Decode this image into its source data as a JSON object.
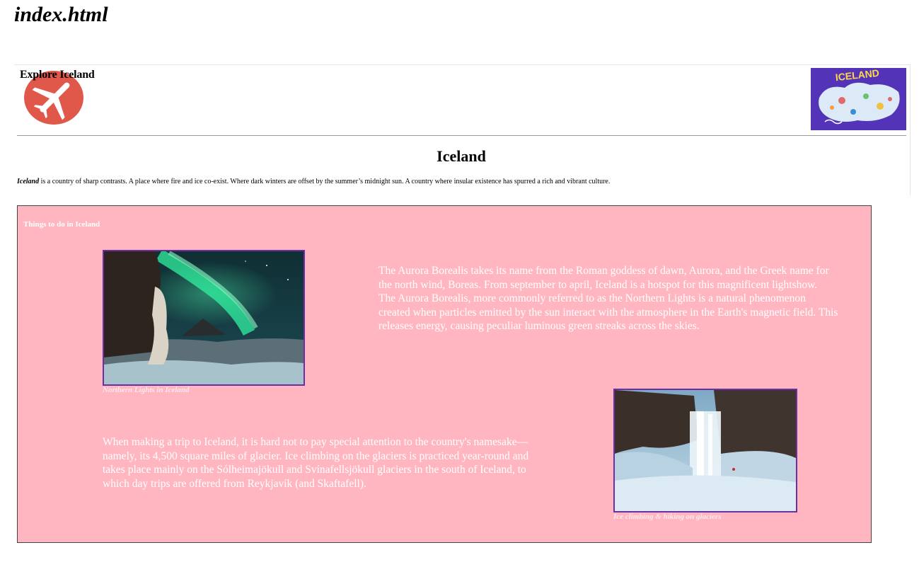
{
  "file_title": "index.html",
  "header": {
    "brand": "Explore Iceland",
    "logo_icon": "airplane-icon",
    "map_icon": "iceland-map-icon",
    "map_text": "ICELAND"
  },
  "main": {
    "heading": "Iceland",
    "intro_lead": "Iceland",
    "intro_rest": " is a country of sharp contrasts. A place where fire and ice co-exist. Where dark winters are offset by the summer’s midnight sun. A country where insular existence has spurred a rich and vibrant culture."
  },
  "things": {
    "heading": "Things to do in Iceland",
    "background": "#ffb6c1",
    "aurora": {
      "caption": "Northern Lights in Iceland",
      "para1": "The Aurora Borealis takes its name from the Roman goddess of dawn, Aurora, and the Greek name for the north wind, Boreas. From september to april, Iceland is a hotspot for this magnificent lightshow.",
      "para2": "The Aurora Borealis, more commonly referred to as the Northern Lights is a natural phenomenon created when particles emitted by the sun interact with the atmosphere in the Earth's magnetic field. This releases energy, causing peculiar luminous green streaks across the skies."
    },
    "ice": {
      "caption": "Ice climbing & hiking on glaciers",
      "text": "When making a trip to Iceland, it is hard not to pay special attention to the country's namesake––namely, its 4,500 square miles of glacier. Ice climbing on the glaciers is practiced year-round and takes place mainly on the Sólheimajökull and Svínafellsjökull glaciers in the south of Iceland, to which day trips are offered from Reykjavík (and Skaftafell)."
    }
  }
}
